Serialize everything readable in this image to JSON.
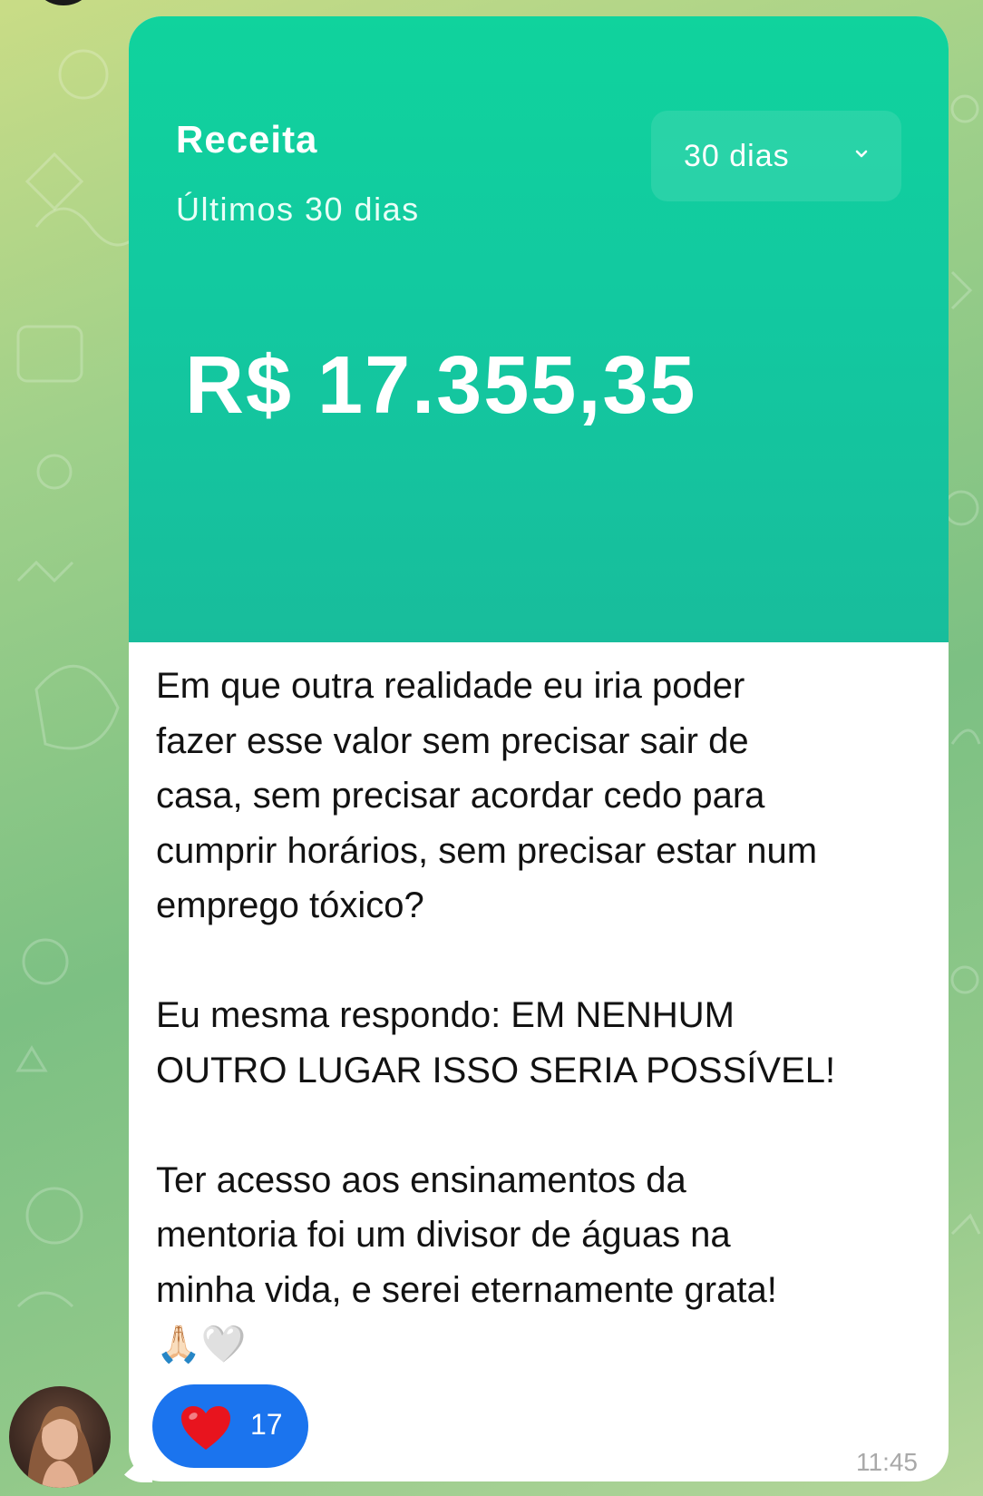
{
  "card": {
    "title": "Receita",
    "subtitle": "Últimos 30 dias",
    "period_label": "30 dias",
    "amount": "R$ 17.355,35",
    "accent_color": "#12c9a0"
  },
  "message": {
    "text": "Em que outra realidade eu iria poder\nfazer esse valor sem precisar sair de\ncasa, sem precisar acordar cedo para\ncumprir horários, sem precisar estar num\nemprego tóxico?\n\nEu mesma respondo: EM NENHUM\nOUTRO LUGAR ISSO SERIA POSSÍVEL!\n\nTer acesso aos ensinamentos da\nmentoria foi um divisor de águas na\nminha vida, e serei eternamente grata!\n🙏🏻🤍",
    "time": "11:45"
  },
  "reaction": {
    "icon": "heart-icon",
    "count": "17",
    "color": "#1b74ee"
  }
}
